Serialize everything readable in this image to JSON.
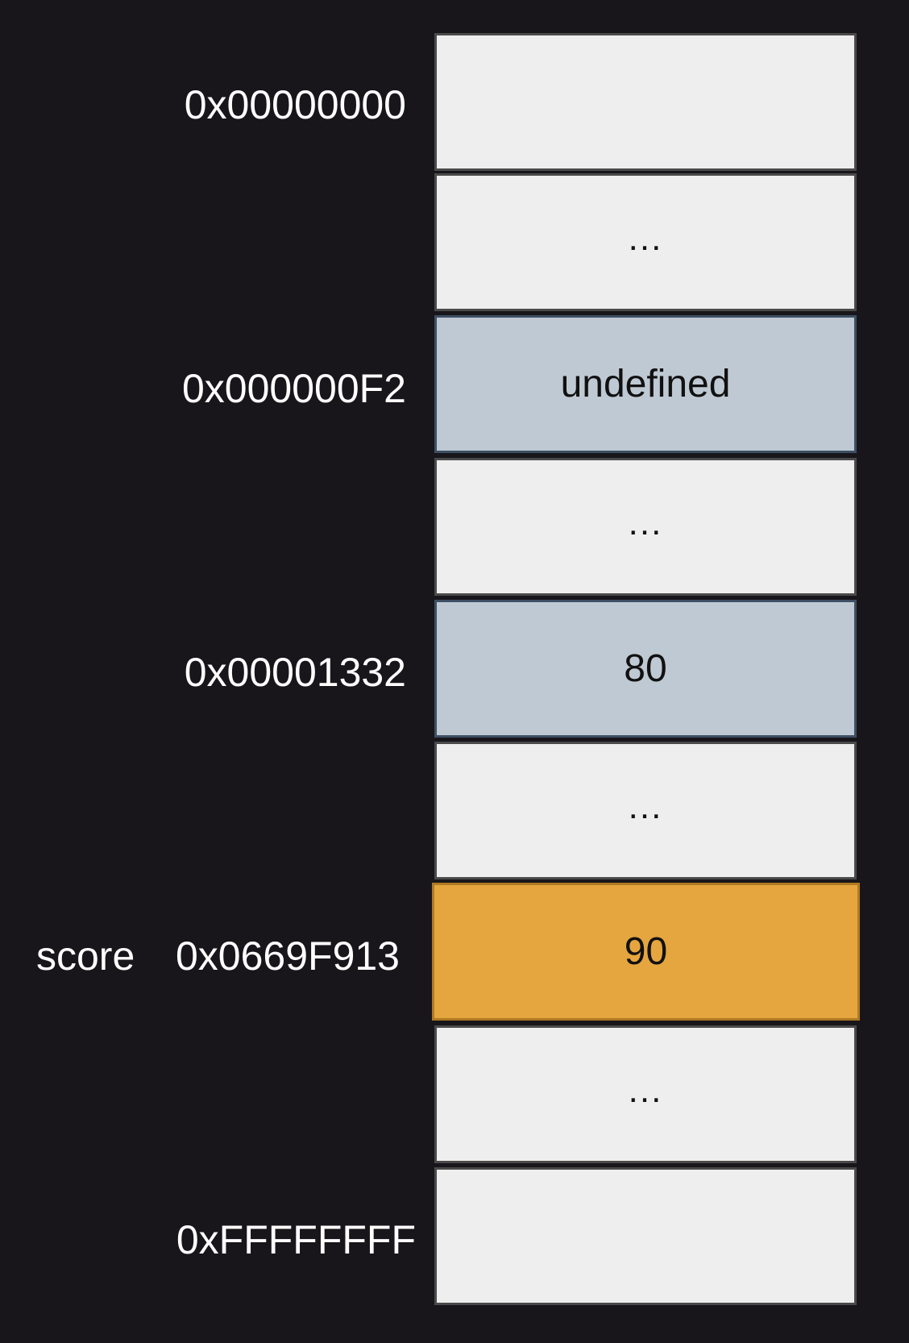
{
  "memory": {
    "cells": [
      {
        "address": "0x00000000",
        "value": "",
        "kind": "plain"
      },
      {
        "address": "",
        "value": "...",
        "kind": "plain"
      },
      {
        "address": "0x000000F2",
        "value": "undefined",
        "kind": "blue"
      },
      {
        "address": "",
        "value": "...",
        "kind": "plain"
      },
      {
        "address": "0x00001332",
        "value": "80",
        "kind": "blue"
      },
      {
        "address": "",
        "value": "...",
        "kind": "plain"
      },
      {
        "address": "0x0669F913",
        "value": "90",
        "kind": "orange",
        "variable": "score"
      },
      {
        "address": "",
        "value": "...",
        "kind": "plain"
      },
      {
        "address": "0xFFFFFFFF",
        "value": "",
        "kind": "plain"
      }
    ]
  },
  "colors": {
    "background": "#18161b",
    "plain_cell": "#eeeeee",
    "highlight_blue": "#bfc9d3",
    "highlight_orange": "#e5a63f"
  }
}
